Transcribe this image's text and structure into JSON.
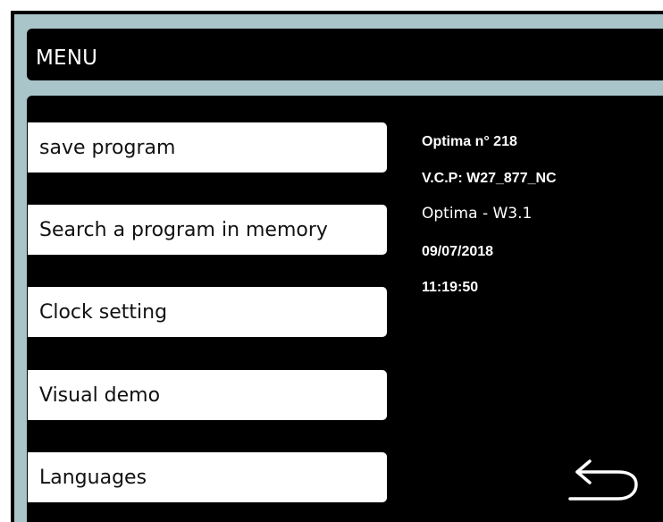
{
  "header": {
    "title": "MENU"
  },
  "menu": {
    "items": [
      {
        "label": "save program"
      },
      {
        "label": "Search a program in memory"
      },
      {
        "label": "Clock setting"
      },
      {
        "label": "Visual demo"
      },
      {
        "label": "Languages"
      }
    ]
  },
  "info": {
    "model": "Optima n° 218",
    "vcp": "V.C.P: W27_877_NC",
    "version": "Optima - W3.1",
    "date": "09/07/2018",
    "time": "11:19:50"
  },
  "icons": {
    "back": "back-arrow-icon"
  },
  "colors": {
    "frame": "#a9c5c9",
    "panel": "#000000",
    "button": "#ffffff",
    "text_light": "#ffffff"
  }
}
